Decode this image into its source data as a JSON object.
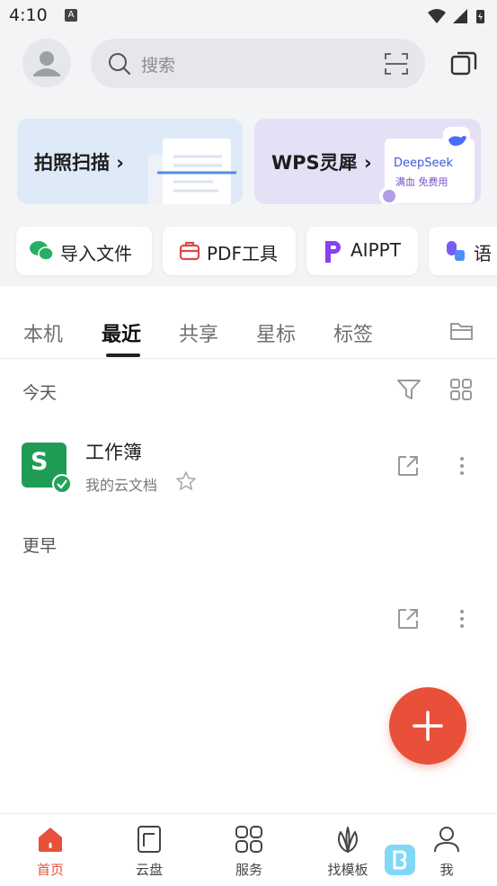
{
  "status_bar": {
    "time": "4:10",
    "notif_letter": "A"
  },
  "search": {
    "placeholder": "搜索"
  },
  "banners": [
    {
      "label": "拍照扫描 ›"
    },
    {
      "label": "WPS灵犀 ›",
      "card_title": "DeepSeek",
      "card_sub": "满血 免费用"
    }
  ],
  "quick_actions": [
    {
      "label": "导入文件"
    },
    {
      "label": "PDF工具"
    },
    {
      "label": "AIPPT"
    },
    {
      "label": "语"
    }
  ],
  "tabs": [
    {
      "label": "本机"
    },
    {
      "label": "最近",
      "active": true
    },
    {
      "label": "共享"
    },
    {
      "label": "星标"
    },
    {
      "label": "标签"
    }
  ],
  "sections": {
    "today": "今天",
    "earlier": "更早"
  },
  "files": [
    {
      "name": "工作簿",
      "location": "我的云文档",
      "icon_letter": "S"
    }
  ],
  "fab": {
    "symbol": "+"
  },
  "bottom_nav": [
    {
      "label": "首页",
      "active": true
    },
    {
      "label": "云盘"
    },
    {
      "label": "服务"
    },
    {
      "label": "找模板"
    },
    {
      "label": "我"
    }
  ],
  "colors": {
    "accent": "#e8503a",
    "spreadsheet_green": "#1f9d55",
    "check_green": "#22a35a"
  }
}
